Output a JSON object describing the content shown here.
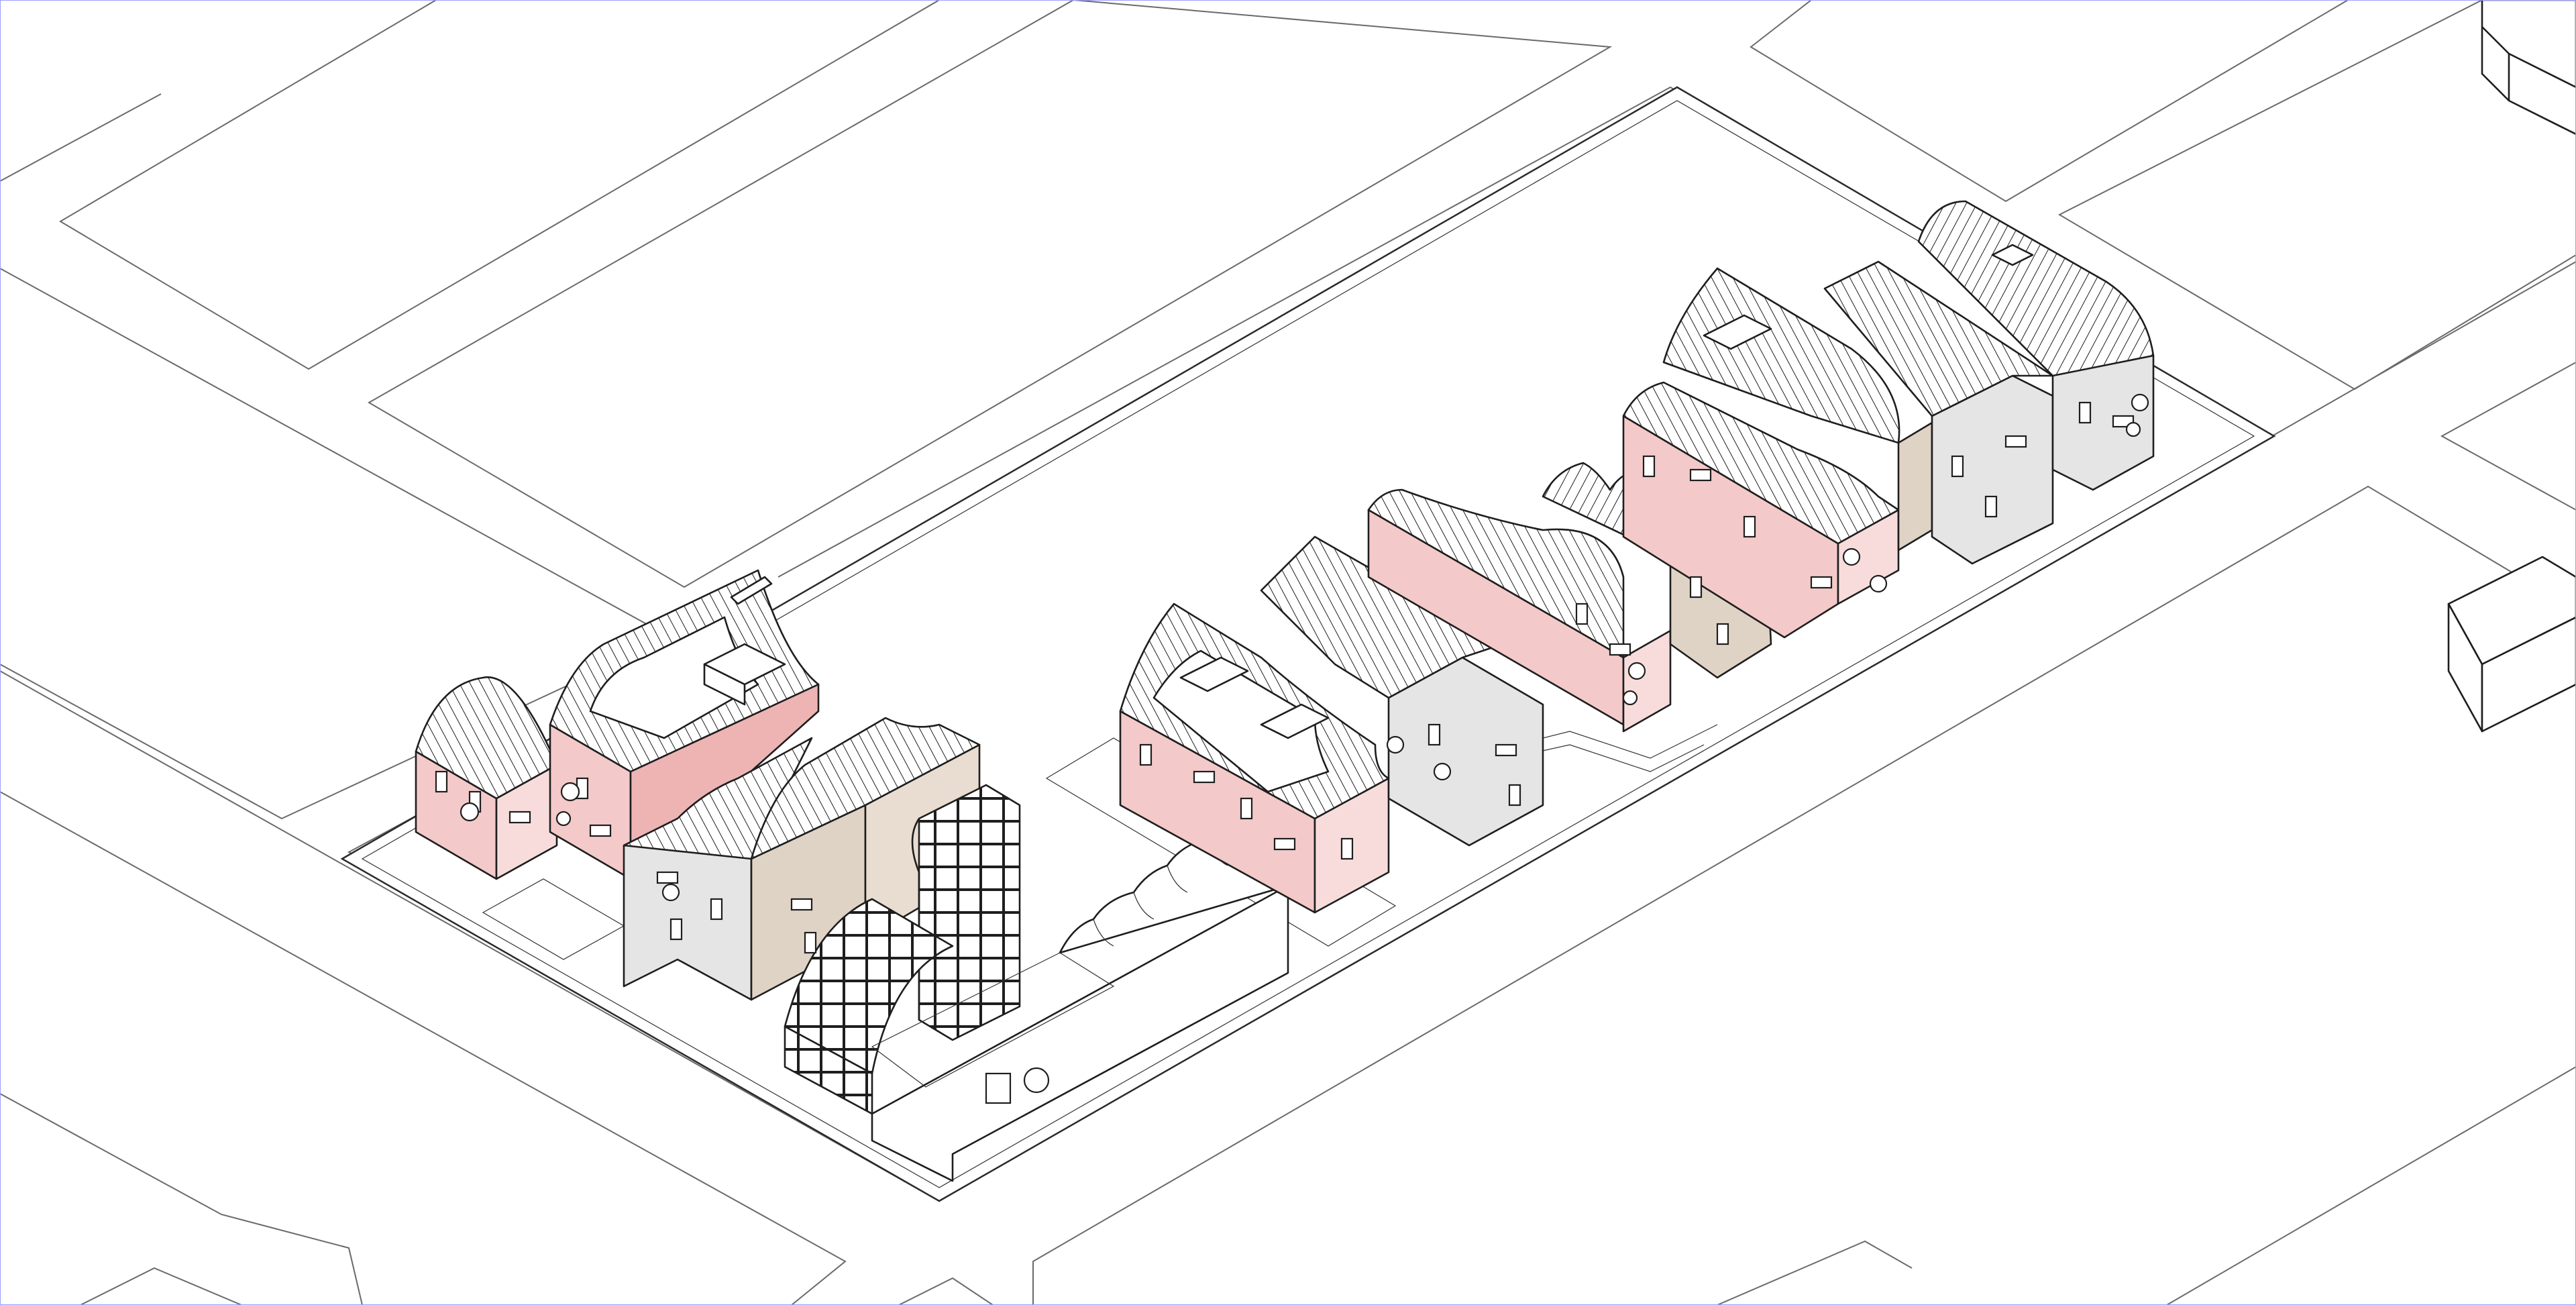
{
  "drawing": {
    "type": "axonometric site drawing",
    "colors": {
      "pink": "#f4c9c9",
      "pink_light": "#f8dcdc",
      "pink_deep": "#eeb4b4",
      "grey": "#e5e5e5",
      "beige": "#dfd3c6",
      "white": "#ffffff",
      "line": "#1e1e1e",
      "street_line": "#6a6a6a"
    }
  }
}
